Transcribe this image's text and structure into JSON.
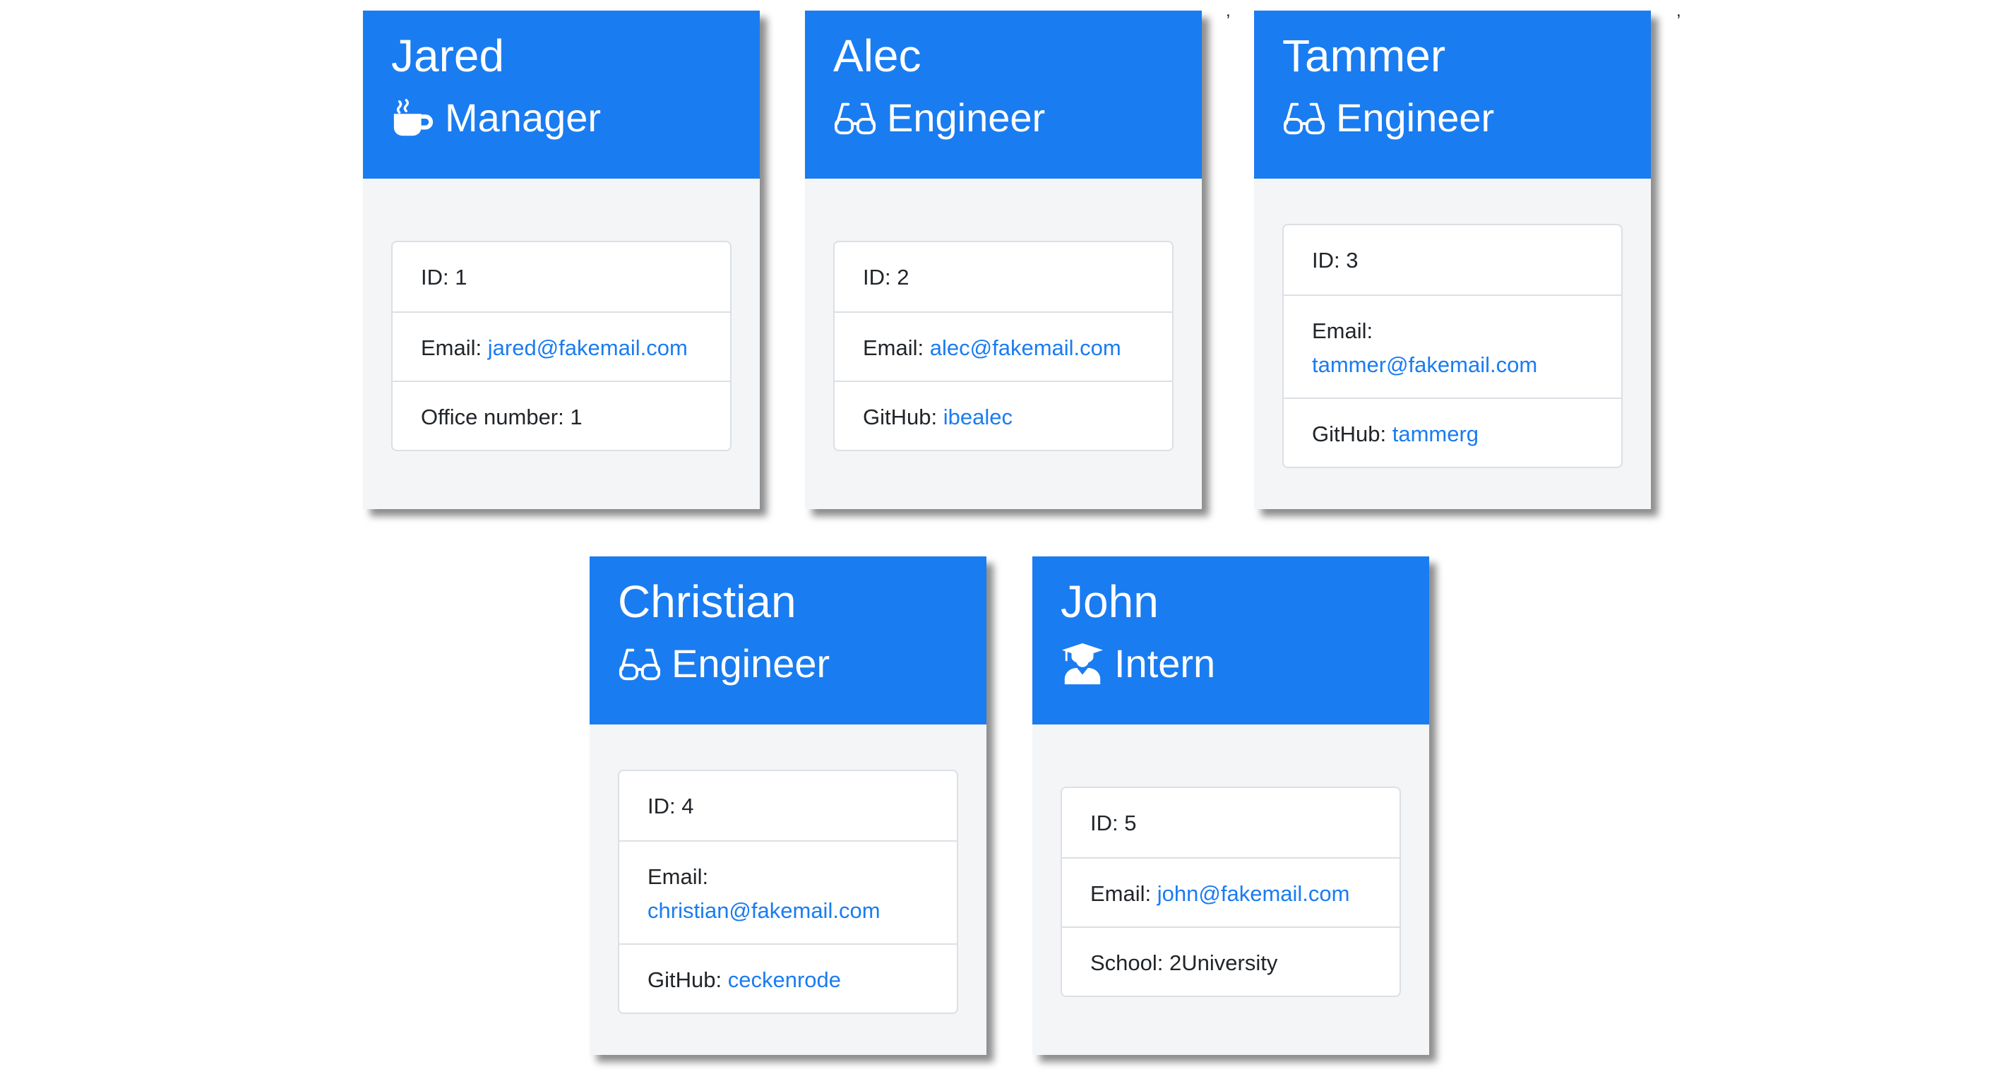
{
  "accent_color": "#1a7cf1",
  "link_color": "#1a7cf1",
  "team": [
    {
      "name": "Jared",
      "role": "Manager",
      "icon": "coffee-mug-icon",
      "id_label": "ID: 1",
      "email_prefix": "Email:",
      "email": "jared@fakemail.com",
      "extra_prefix": "Office number: 1",
      "extra_value": ""
    },
    {
      "name": "Alec",
      "role": "Engineer",
      "icon": "glasses-icon",
      "id_label": "ID: 2",
      "email_prefix": "Email:",
      "email": "alec@fakemail.com",
      "extra_prefix": "GitHub:",
      "extra_value": "ibealec"
    },
    {
      "name": "Tammer",
      "role": "Engineer",
      "icon": "glasses-icon",
      "id_label": "ID: 3",
      "email_prefix": "Email:",
      "email": "tammer@fakemail.com",
      "extra_prefix": "GitHub:",
      "extra_value": "tammerg"
    },
    {
      "name": "Christian",
      "role": "Engineer",
      "icon": "glasses-icon",
      "id_label": "ID: 4",
      "email_prefix": "Email:",
      "email": "christian@fakemail.com",
      "extra_prefix": "GitHub:",
      "extra_value": "ceckenrode"
    },
    {
      "name": "John",
      "role": "Intern",
      "icon": "graduate-icon",
      "id_label": "ID: 5",
      "email_prefix": "Email:",
      "email": "john@fakemail.com",
      "extra_prefix": "School: 2University",
      "extra_value": ""
    }
  ],
  "stray_marks": [
    ",",
    ","
  ]
}
